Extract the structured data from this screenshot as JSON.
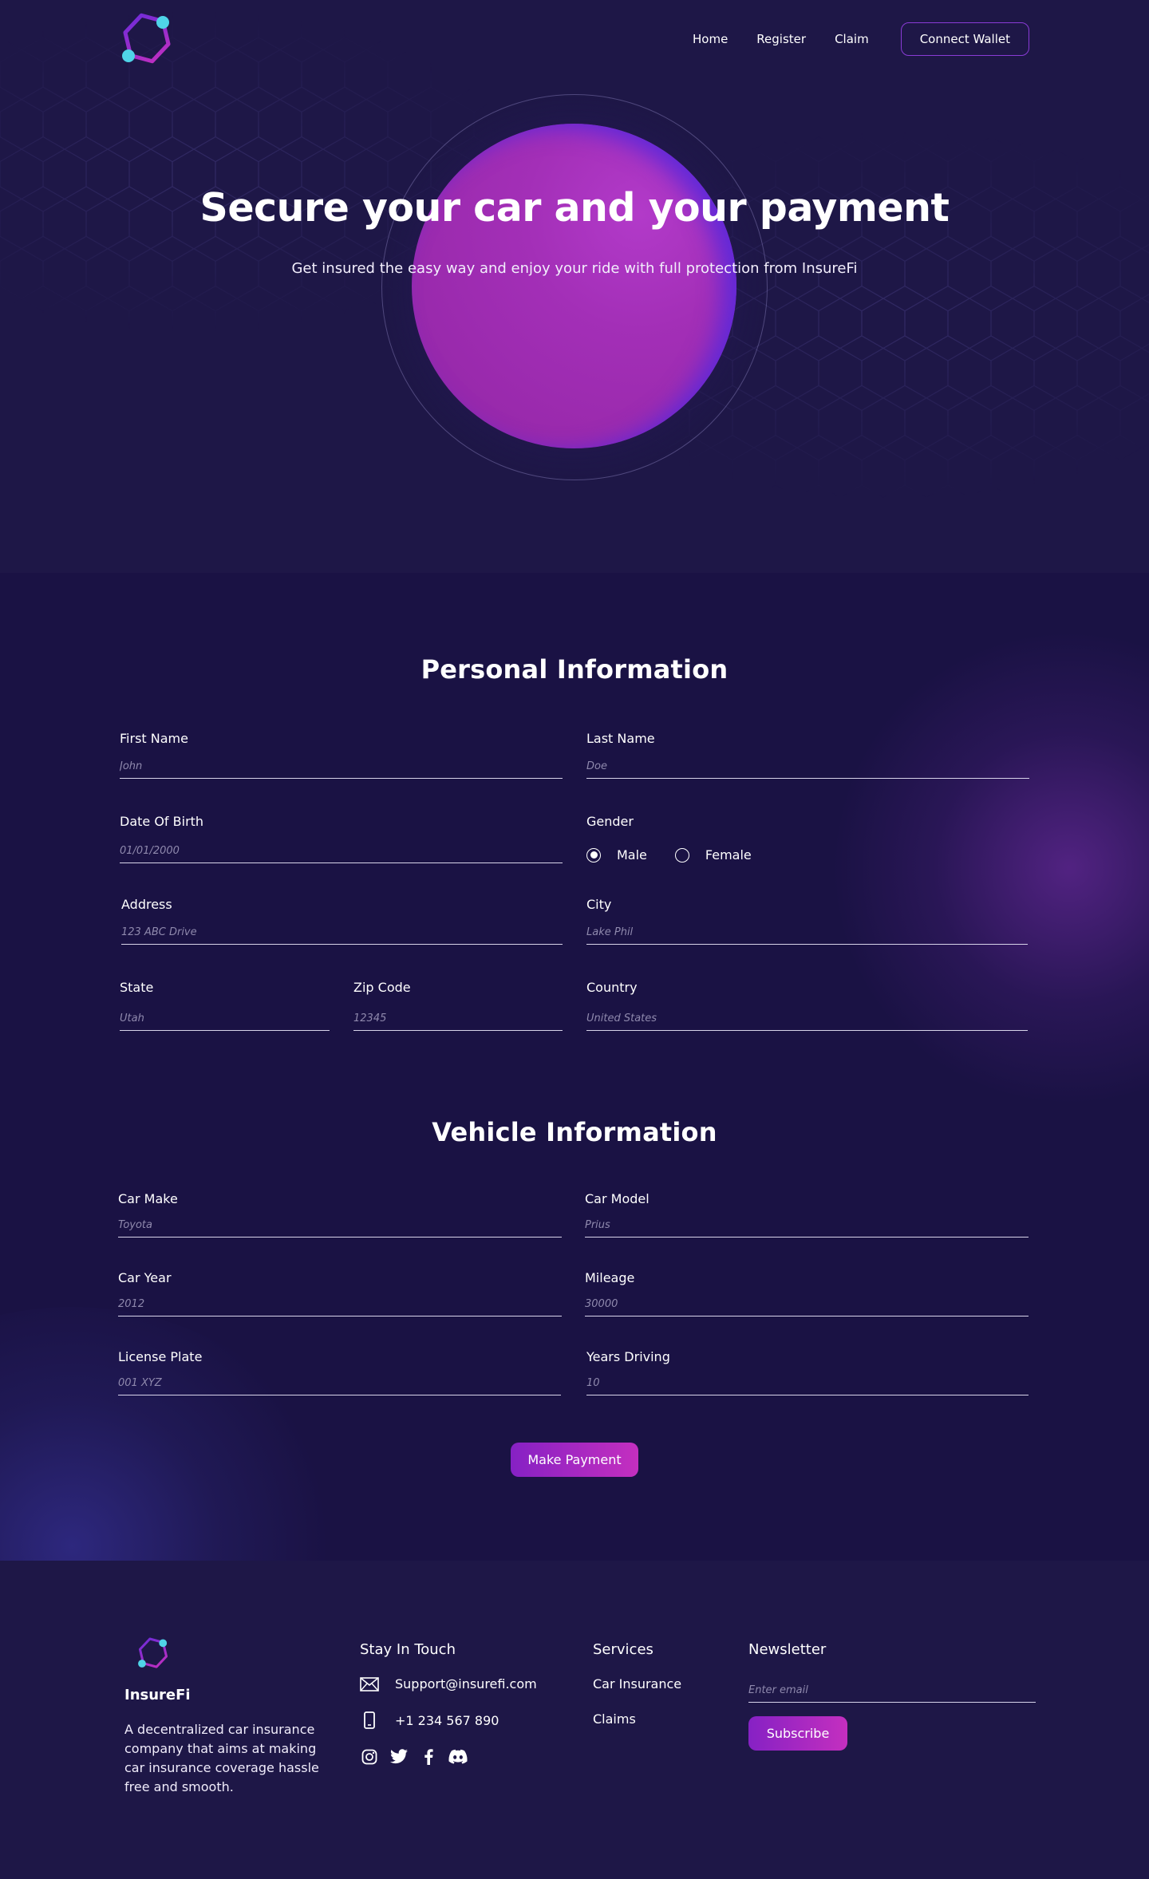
{
  "colors": {
    "background": "#1c1546",
    "accent_purple": "#8621c4",
    "accent_pink": "#c42fbf",
    "orb": "#a32fb7",
    "logo_cyan": "#4fd4e8"
  },
  "nav": {
    "logo_icon": "hexagon-logo-icon",
    "links": [
      "Home",
      "Register",
      "Claim"
    ],
    "connect_wallet": "Connect Wallet"
  },
  "hero": {
    "title": "Secure your car and your payment",
    "subtitle": "Get insured the easy way and enjoy your ride with full protection from InsureFi"
  },
  "personal": {
    "title": "Personal Information",
    "first_name": {
      "label": "First Name",
      "placeholder": "John"
    },
    "last_name": {
      "label": "Last Name",
      "placeholder": "Doe"
    },
    "dob": {
      "label": "Date Of Birth",
      "placeholder": "01/01/2000"
    },
    "gender": {
      "label": "Gender",
      "options": [
        "Male",
        "Female"
      ],
      "selected": "Male"
    },
    "address": {
      "label": "Address",
      "placeholder": "123 ABC Drive"
    },
    "city": {
      "label": "City",
      "placeholder": "Lake Phil"
    },
    "state": {
      "label": "State",
      "placeholder": "Utah"
    },
    "zip": {
      "label": "Zip Code",
      "placeholder": "12345"
    },
    "country": {
      "label": "Country",
      "placeholder": "United States"
    }
  },
  "vehicle": {
    "title": "Vehicle Information",
    "make": {
      "label": "Car Make",
      "placeholder": "Toyota"
    },
    "model": {
      "label": "Car Model",
      "placeholder": "Prius"
    },
    "year": {
      "label": "Car Year",
      "placeholder": "2012"
    },
    "mileage": {
      "label": "Mileage",
      "placeholder": "30000"
    },
    "plate": {
      "label": "License Plate",
      "placeholder": "001 XYZ"
    },
    "years_driving": {
      "label": "Years Driving",
      "placeholder": "10"
    }
  },
  "make_payment": "Make Payment",
  "footer": {
    "brand": "InsureFi",
    "description": "A decentralized car insurance company that aims at making car insurance coverage hassle free and smooth.",
    "stay_in_touch": "Stay In Touch",
    "email": "Support@insurefi.com",
    "phone": "+1 234 567 890",
    "socials": [
      "instagram-icon",
      "twitter-icon",
      "facebook-icon",
      "discord-icon"
    ],
    "services_title": "Services",
    "services": [
      "Car Insurance",
      "Claims"
    ],
    "newsletter_title": "Newsletter",
    "newsletter_placeholder": "Enter email",
    "subscribe": "Subscribe"
  }
}
